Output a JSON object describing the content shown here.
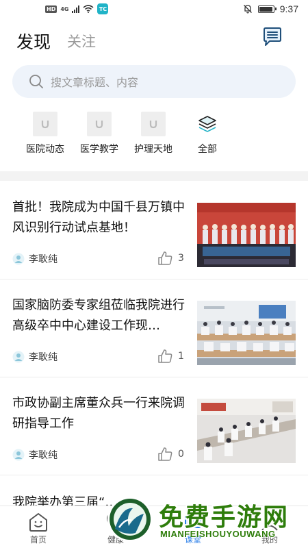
{
  "status_bar": {
    "hd": "HD",
    "signal": "4G",
    "app_badge": "TC",
    "time": "9:37",
    "battery_level": 0.95
  },
  "header": {
    "tab_discover": "发现",
    "tab_follow": "关注",
    "message_icon": "message-list-icon"
  },
  "search": {
    "placeholder": "搜文章标题、内容",
    "icon": "search-icon"
  },
  "categories": [
    {
      "label": "医院动态",
      "icon": "image-placeholder-icon"
    },
    {
      "label": "医学教学",
      "icon": "image-placeholder-icon"
    },
    {
      "label": "护理天地",
      "icon": "image-placeholder-icon"
    },
    {
      "label": "全部",
      "icon": "layers-icon"
    }
  ],
  "articles": [
    {
      "title": "首批！我院成为中国千县万镇中风识别行动试点基地！",
      "author": "李耿纯",
      "likes": "3"
    },
    {
      "title": "国家脑防委专家组莅临我院进行高级卒中中心建设工作现…",
      "author": "李耿纯",
      "likes": "1"
    },
    {
      "title": "市政协副主席董众兵一行来院调研指导工作",
      "author": "李耿纯",
      "likes": "0"
    },
    {
      "title": "我院举办第三届“…",
      "author": "",
      "likes": ""
    }
  ],
  "bottom_nav": [
    {
      "label": "首页",
      "icon": "home-face-icon",
      "active": false
    },
    {
      "label": "健康",
      "icon": "health-icon",
      "active": false
    },
    {
      "label": "课堂",
      "icon": "classroom-icon",
      "active": true
    },
    {
      "label": "我的",
      "icon": "profile-icon",
      "active": false
    }
  ],
  "watermark": {
    "text": "免费手游网",
    "sub": "MIANFEISHOUYOUWANG"
  },
  "colors": {
    "accent": "#2a7ee8",
    "search_bg": "#eef3fa",
    "watermark": "#2e7d0b"
  }
}
